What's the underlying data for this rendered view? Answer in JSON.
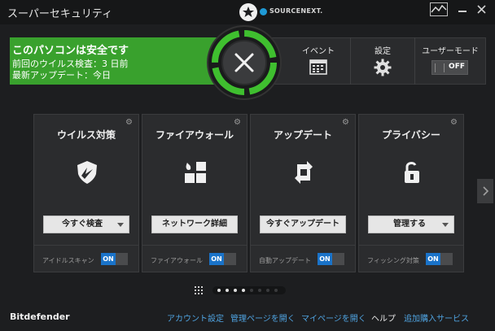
{
  "window": {
    "title": "スーパーセキュリティ",
    "brand": "SOURCENEXT."
  },
  "status": {
    "title": "このパソコンは安全です",
    "last_scan": "前回のウイルス検査：3 日前",
    "last_update": "最新アップデート：今日",
    "color": "#39a12d"
  },
  "strip": {
    "event_label": "イベント",
    "settings_label": "設定",
    "user_mode_label": "ユーザーモード",
    "user_mode_value": "OFF"
  },
  "cards": [
    {
      "title": "ウイルス対策",
      "button": "今すぐ検査",
      "footer": "アイドルスキャン",
      "toggle": "ON",
      "icon": "shield-icon",
      "has_dropdown": true
    },
    {
      "title": "ファイアウォール",
      "button": "ネットワーク詳細",
      "footer": "ファイアウォール",
      "toggle": "ON",
      "icon": "firewall-icon",
      "has_dropdown": false
    },
    {
      "title": "アップデート",
      "button": "今すぐアップデート",
      "footer": "自動アップデート",
      "toggle": "ON",
      "icon": "update-icon",
      "has_dropdown": false
    },
    {
      "title": "プライバシー",
      "button": "管理する",
      "footer": "フィッシング対策",
      "toggle": "ON",
      "icon": "lock-icon",
      "has_dropdown": true
    }
  ],
  "footer": {
    "brand": "Bitdefender",
    "links": [
      "アカウント設定",
      "管理ページを開く",
      "マイページを開く",
      "ヘルプ",
      "追加購入サービス"
    ]
  },
  "colors": {
    "accent_green": "#39a12d",
    "toggle_on": "#1a73c9",
    "link": "#4fa3e0"
  }
}
